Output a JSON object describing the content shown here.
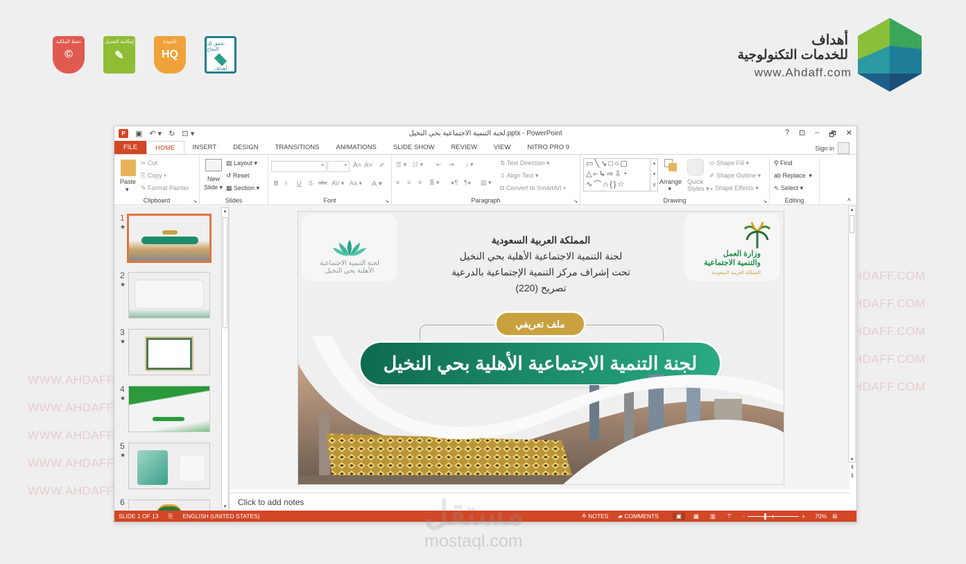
{
  "branding": {
    "name_ar": "أهداف",
    "subtitle_ar": "للخدمات التكنولوجية",
    "url": "www.Ahdaff.com",
    "badges": [
      {
        "label": "حفظ الملكية",
        "symbol": "©",
        "color": "#e05a50"
      },
      {
        "label": "إمكانية التعديل",
        "symbol": "✎",
        "color": "#8fbd35"
      },
      {
        "label": "الجودة",
        "symbol": "HQ",
        "color": "#f0a23a"
      },
      {
        "label": "تحقق لك النجاح",
        "symbol": "أهداف",
        "color": "#1d7f8d"
      }
    ]
  },
  "window": {
    "title": "لجنة التنمية الاجتماعية بحي النخيل.pptx - PowerPoint",
    "controls": [
      "?",
      "⊡",
      "–",
      "🗗",
      "✕"
    ],
    "sign_in": "Sign in"
  },
  "tabs": [
    "FILE",
    "HOME",
    "INSERT",
    "DESIGN",
    "TRANSITIONS",
    "ANIMATIONS",
    "SLIDE SHOW",
    "REVIEW",
    "VIEW",
    "NITRO PRO 9"
  ],
  "active_tab": "HOME",
  "ribbon": {
    "clipboard": {
      "label": "Clipboard",
      "paste": "Paste",
      "cut": "Cut",
      "copy": "Copy",
      "format_painter": "Format Painter"
    },
    "slides": {
      "label": "Slides",
      "new_slide_1": "New",
      "new_slide_2": "Slide",
      "layout": "Layout",
      "reset": "Reset",
      "section": "Section"
    },
    "font": {
      "label": "Font",
      "font_name": "",
      "font_size": "",
      "bold": "B",
      "italic": "I",
      "underline": "U",
      "shadow": "S",
      "strike": "abc",
      "spacing": "AV",
      "case": "Aa",
      "color": "A"
    },
    "paragraph": {
      "label": "Paragraph",
      "text_direction": "Text Direction",
      "align_text": "Align Text",
      "smartart": "Convert to SmartArt"
    },
    "drawing": {
      "label": "Drawing",
      "arrange": "Arrange",
      "quick_styles_1": "Quick",
      "quick_styles_2": "Styles",
      "shape_fill": "Shape Fill",
      "shape_outline": "Shape Outline",
      "shape_effects": "Shape Effects"
    },
    "editing": {
      "label": "Editing",
      "find": "Find",
      "replace": "Replace",
      "select": "Select"
    }
  },
  "thumbnails": [
    {
      "num": "1",
      "selected": true
    },
    {
      "num": "2",
      "selected": false
    },
    {
      "num": "3",
      "selected": false
    },
    {
      "num": "4",
      "selected": false
    },
    {
      "num": "5",
      "selected": false
    },
    {
      "num": "6",
      "selected": false
    }
  ],
  "slide": {
    "line1": "المملكة العربية السعودية",
    "line2": "لجنة التنمية الاجتماعية الأهلية بحي النخيل",
    "line3": "تحت إشراف مركز التنمية الإجتماعية بالدرعية",
    "line4": "تصريح (220)",
    "left_logo_1": "لجنة التنمية الاجتماعية",
    "left_logo_2": "الأهلية بحي النخيل",
    "right_logo_1": "وزارة العمل",
    "right_logo_2": "والتنمية الاجتماعية",
    "right_logo_3": "المملكة العربية السعودية",
    "badge": "ملف تعريفي",
    "main_title": "لجنة التنمية الاجتماعية الأهلية بحي النخيل"
  },
  "notes_placeholder": "Click to add notes",
  "status": {
    "slide": "SLIDE 1 OF 13",
    "language": "ENGLISH (UNITED STATES)",
    "notes": "NOTES",
    "comments": "COMMENTS",
    "zoom_minus": "-",
    "zoom_plus": "+",
    "zoom": "70%",
    "zoom_level_percent": 70
  },
  "watermark": {
    "text": "WWW.AHDAFF.COM",
    "mostaql_ar": "مستقل",
    "mostaql_url": "mostaql.com"
  },
  "colors": {
    "accent": "#d24726",
    "slide_green": "#1d8c6a",
    "badge_gold": "#c9a13f"
  }
}
